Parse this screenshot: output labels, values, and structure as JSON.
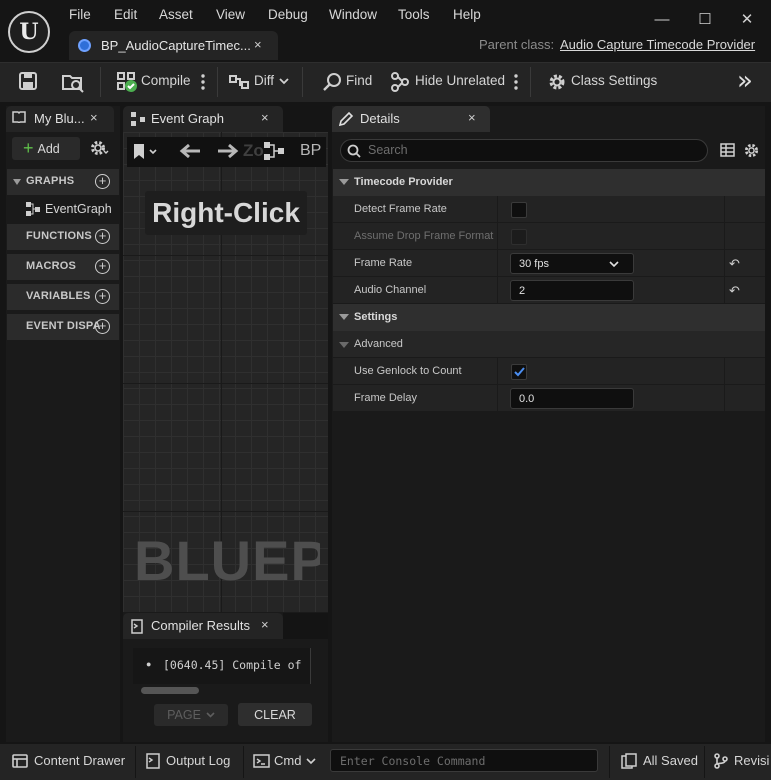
{
  "app": {
    "logo_letter": "U"
  },
  "menu": [
    "File",
    "Edit",
    "Asset",
    "View",
    "Debug",
    "Window",
    "Tools",
    "Help"
  ],
  "window_controls": {
    "minimize": "—",
    "maximize": "☐",
    "close": "✕"
  },
  "asset_tab": {
    "label": "BP_AudioCaptureTimec...",
    "close": "×"
  },
  "parent_class": {
    "label": "Parent class:",
    "value": "Audio Capture Timecode Provider"
  },
  "toolbar": {
    "compile": "Compile",
    "diff": "Diff",
    "find": "Find",
    "hide_unrelated": "Hide Unrelated",
    "class_settings": "Class Settings",
    "overflow": "»"
  },
  "my_blueprint": {
    "tab_label": "My Blu...",
    "add_label": "Add",
    "sections": [
      {
        "label": "GRAPHS",
        "items": [
          "EventGraph"
        ]
      },
      {
        "label": "FUNCTIONS"
      },
      {
        "label": "MACROS"
      },
      {
        "label": "VARIABLES"
      },
      {
        "label": "EVENT DISPA"
      }
    ]
  },
  "event_graph": {
    "tab_label": "Event Graph",
    "zoom_text": "Zo",
    "bp_text": "BP",
    "hint": "Right-Click",
    "watermark": "BLUEPI"
  },
  "compiler_results": {
    "tab_label": "Compiler Results",
    "messages": [
      "[0640.45] Compile of"
    ],
    "page_label": "PAGE",
    "clear_label": "CLEAR"
  },
  "details": {
    "tab_label": "Details",
    "search_placeholder": "Search",
    "categories": [
      {
        "label": "Timecode Provider",
        "rows": [
          {
            "name": "Detect Frame Rate",
            "type": "checkbox",
            "checked": false
          },
          {
            "name": "Assume Drop Frame Format",
            "type": "checkbox",
            "checked": false,
            "disabled": true
          },
          {
            "name": "Frame Rate",
            "type": "dropdown",
            "value": "30 fps"
          },
          {
            "name": "Audio Channel",
            "type": "number",
            "value": "2"
          }
        ]
      },
      {
        "label": "Settings",
        "subcategory": "Advanced",
        "rows": [
          {
            "name": "Use Genlock to Count",
            "type": "checkbox",
            "checked": true
          },
          {
            "name": "Frame Delay",
            "type": "number",
            "value": "0.0"
          }
        ]
      }
    ]
  },
  "statusbar": {
    "content_drawer": "Content Drawer",
    "output_log": "Output Log",
    "cmd": "Cmd",
    "console_placeholder": "Enter Console Command",
    "all_saved": "All Saved",
    "revision": "Revisi"
  },
  "colors": {
    "accent": "#2f6fd8",
    "check": "#4a8df0",
    "compile_ok": "#4caf50"
  }
}
